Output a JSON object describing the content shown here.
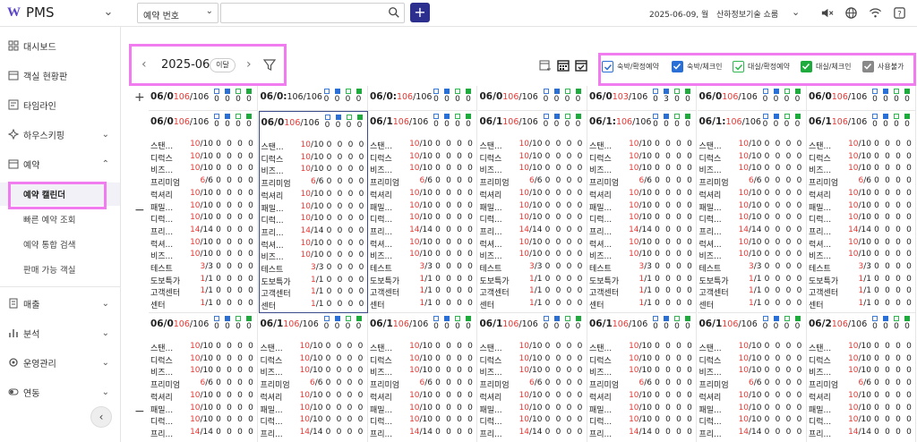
{
  "app": {
    "logo_mark": "W",
    "logo_text": "PMS"
  },
  "topbar": {
    "search_type": "예약 번호",
    "search_placeholder": "",
    "date": "2025-06-09, 월",
    "company": "산하정보기술 쇼룸"
  },
  "sidebar": {
    "items": [
      {
        "label": "대시보드",
        "icon": "dashboard-icon"
      },
      {
        "label": "객실 현황판",
        "icon": "calendar-icon"
      },
      {
        "label": "타임라인",
        "icon": "timeline-icon"
      },
      {
        "label": "하우스키핑",
        "icon": "housekeeping-icon"
      },
      {
        "label": "예약",
        "icon": "calendar-icon"
      },
      {
        "label": "매출",
        "icon": "receipt-icon"
      },
      {
        "label": "분석",
        "icon": "chart-icon"
      },
      {
        "label": "운영관리",
        "icon": "gear-icon"
      },
      {
        "label": "연동",
        "icon": "toggle-icon"
      }
    ],
    "reservation_sub": [
      {
        "label": "예약 캘린더",
        "active": true
      },
      {
        "label": "빠른 예약 조회"
      },
      {
        "label": "예약 통합 검색"
      },
      {
        "label": "판매 가능 객실"
      }
    ]
  },
  "calendar": {
    "month": "2025-06",
    "this_month_btn": "이달",
    "legend": [
      {
        "label": "숙박/확정예약",
        "style": "outline-blue"
      },
      {
        "label": "숙박/체크인",
        "style": "filled-blue"
      },
      {
        "label": "대실/확정예약",
        "style": "outline-green"
      },
      {
        "label": "대실/체크인",
        "style": "filled-green"
      },
      {
        "label": "사용불가",
        "style": "filled-gray"
      }
    ],
    "colors": {
      "red": "#e53935",
      "blue": "#2a6fd6",
      "green": "#1faa3d",
      "highlight": "#f07cf0"
    },
    "header_row": {
      "days": [
        {
          "date": "06/0",
          "avail": "106",
          "total": "/106",
          "vals": [
            "0",
            "0",
            "0",
            "0"
          ]
        },
        {
          "date": "06/0:",
          "avail": "",
          "total": "106/106",
          "vals": [
            "0",
            "0",
            "0",
            "0"
          ]
        },
        {
          "date": "06/0:",
          "avail": "106",
          "total": "/106",
          "vals": [
            "0",
            "0",
            "0",
            "0"
          ]
        },
        {
          "date": "06/0",
          "avail": "106",
          "total": "/106",
          "vals": [
            "0",
            "0",
            "0",
            "0"
          ]
        },
        {
          "date": "06/0",
          "avail": "103",
          "total": "/106",
          "vals": [
            "0",
            "3",
            "0",
            "0"
          ]
        },
        {
          "date": "06/0",
          "avail": "106",
          "total": "/106",
          "vals": [
            "0",
            "0",
            "0",
            "0"
          ]
        },
        {
          "date": "06/0",
          "avail": "106",
          "total": "/106",
          "vals": [
            "0",
            "0",
            "0",
            "0"
          ]
        },
        {
          "date": "06/0",
          "avail": "106",
          "total": "/106",
          "vals": [
            "0",
            "0",
            "0",
            "0"
          ]
        }
      ]
    },
    "week_rows": [
      {
        "days": [
          {
            "date": "06/0",
            "avail": "106",
            "total": "/106",
            "vals": [
              "0",
              "0",
              "0",
              "0"
            ]
          },
          {
            "date": "06/0",
            "avail": "106",
            "total": "/106",
            "vals": [
              "0",
              "0",
              "0",
              "0"
            ],
            "selected": true
          },
          {
            "date": "06/1",
            "avail": "106",
            "total": "/106",
            "vals": [
              "0",
              "0",
              "0",
              "0"
            ]
          },
          {
            "date": "06/1",
            "avail": "106",
            "total": "/106",
            "vals": [
              "0",
              "0",
              "0",
              "0"
            ]
          },
          {
            "date": "06/1:",
            "avail": "106",
            "total": "/106",
            "vals": [
              "0",
              "0",
              "0",
              "0"
            ]
          },
          {
            "date": "06/1:",
            "avail": "106",
            "total": "/106",
            "vals": [
              "0",
              "0",
              "0",
              "0"
            ]
          },
          {
            "date": "06/1",
            "avail": "106",
            "total": "/106",
            "vals": [
              "0",
              "0",
              "0",
              "0"
            ]
          }
        ]
      },
      {
        "days": [
          {
            "date": "06/0",
            "avail": "106",
            "total": "/106",
            "vals": [
              "0",
              "0",
              "0",
              "0"
            ]
          },
          {
            "date": "06/1",
            "avail": "106",
            "total": "/106",
            "vals": [
              "0",
              "0",
              "0",
              "0"
            ]
          },
          {
            "date": "06/1",
            "avail": "106",
            "total": "/106",
            "vals": [
              "0",
              "0",
              "0",
              "0"
            ]
          },
          {
            "date": "06/1",
            "avail": "106",
            "total": "/106",
            "vals": [
              "0",
              "0",
              "0",
              "0"
            ]
          },
          {
            "date": "06/1",
            "avail": "106",
            "total": "/106",
            "vals": [
              "0",
              "0",
              "0",
              "0"
            ]
          },
          {
            "date": "06/1",
            "avail": "106",
            "total": "/106",
            "vals": [
              "0",
              "0",
              "0",
              "0"
            ]
          },
          {
            "date": "06/2",
            "avail": "106",
            "total": "/106",
            "vals": [
              "0",
              "0",
              "0",
              "0"
            ]
          },
          {
            "date": "06/2",
            "avail": "106",
            "total": "/106",
            "vals": [
              "0",
              "0",
              "0",
              "0"
            ]
          }
        ]
      }
    ],
    "rooms_row1": [
      {
        "name": "스탠...",
        "a": "10",
        "t": "/10"
      },
      {
        "name": "디럭스",
        "a": "10",
        "t": "/10"
      },
      {
        "name": "비즈...",
        "a": "10",
        "t": "/10"
      },
      {
        "name": "프리미엄",
        "a": "6",
        "t": "/6"
      },
      {
        "name": "럭셔리",
        "a": "10",
        "t": "/10"
      },
      {
        "name": "패밀...",
        "a": "10",
        "t": "/10"
      },
      {
        "name": "디럭...",
        "a": "10",
        "t": "/10"
      },
      {
        "name": "프리...",
        "a": "14",
        "t": "/14"
      },
      {
        "name": "럭셔...",
        "a": "10",
        "t": "/10"
      },
      {
        "name": "비즈...",
        "a": "10",
        "t": "/10"
      },
      {
        "name": "테스트",
        "a": "3",
        "t": "/3"
      },
      {
        "name": "도보특가",
        "a": "1",
        "t": "/1"
      },
      {
        "name": "고객센터",
        "a": "1",
        "t": "/1"
      },
      {
        "name": "센터",
        "a": "1",
        "t": "/1"
      }
    ],
    "rooms_row2": [
      {
        "name": "스탠...",
        "a": "10",
        "t": "/10"
      },
      {
        "name": "디럭스",
        "a": "10",
        "t": "/10"
      },
      {
        "name": "비즈...",
        "a": "10",
        "t": "/10"
      },
      {
        "name": "프리미엄",
        "a": "6",
        "t": "/6"
      },
      {
        "name": "럭셔리",
        "a": "10",
        "t": "/10"
      },
      {
        "name": "패밀...",
        "a": "10",
        "t": "/10"
      },
      {
        "name": "디럭...",
        "a": "10",
        "t": "/10"
      },
      {
        "name": "프리...",
        "a": "14",
        "t": "/14"
      }
    ]
  }
}
